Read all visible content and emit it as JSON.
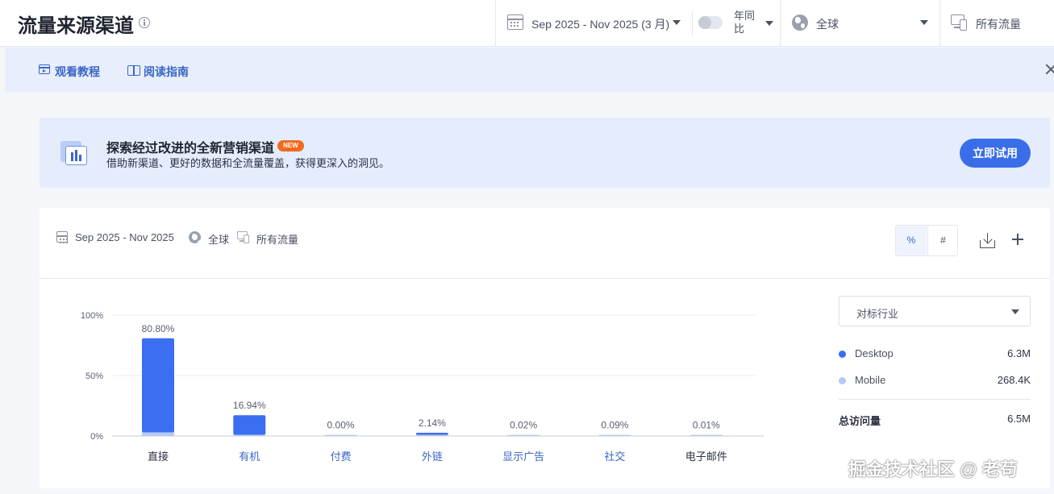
{
  "header": {
    "title": "流量来源渠道",
    "date_range": "Sep 2025 - Nov 2025 (3 月)",
    "yoy_label": "年同比",
    "region": "全球",
    "traffic_type": "所有流量"
  },
  "tutorial": {
    "watch_label": "观看教程",
    "read_label": "阅读指南"
  },
  "promo": {
    "title": "探索经过改进的全新营销渠道",
    "badge": "NEW",
    "subtitle": "借助新渠道、更好的数据和全流量覆盖，获得更深入的洞见。",
    "button": "立即试用"
  },
  "card": {
    "date_range": "Sep 2025 - Nov 2025",
    "region": "全球",
    "traffic_type": "所有流量",
    "percent_toggle": "%",
    "number_toggle": "#"
  },
  "colors": {
    "desktop": "#3b6ef0",
    "mobile": "#b6c9f5",
    "link": "#3a66c7"
  },
  "chart_data": {
    "type": "bar",
    "stacked": true,
    "categories": [
      "直接",
      "有机",
      "付费",
      "外链",
      "显示广告",
      "社交",
      "电子邮件"
    ],
    "category_link": [
      false,
      true,
      true,
      true,
      true,
      true,
      false
    ],
    "series": [
      {
        "name": "Desktop",
        "values": [
          77.9,
          16.3,
          0.0,
          1.8,
          0.01,
          0.06,
          0.0
        ]
      },
      {
        "name": "Mobile",
        "values": [
          2.9,
          0.64,
          0.0,
          0.34,
          0.01,
          0.03,
          0.01
        ]
      }
    ],
    "data_labels": [
      "80.80%",
      "16.94%",
      "0.00%",
      "2.14%",
      "0.02%",
      "0.09%",
      "0.01%"
    ],
    "y_ticks": [
      "100%",
      "50%",
      "0%"
    ],
    "ylim": [
      0,
      100
    ],
    "grid": true
  },
  "legend": {
    "benchmark": "对标行业",
    "items": [
      {
        "name": "Desktop",
        "value": "6.3M"
      },
      {
        "name": "Mobile",
        "value": "268.4K"
      }
    ],
    "total_label": "总访问量",
    "total_value": "6.5M"
  },
  "watermark": "掘金技术社区 @ 老苟"
}
